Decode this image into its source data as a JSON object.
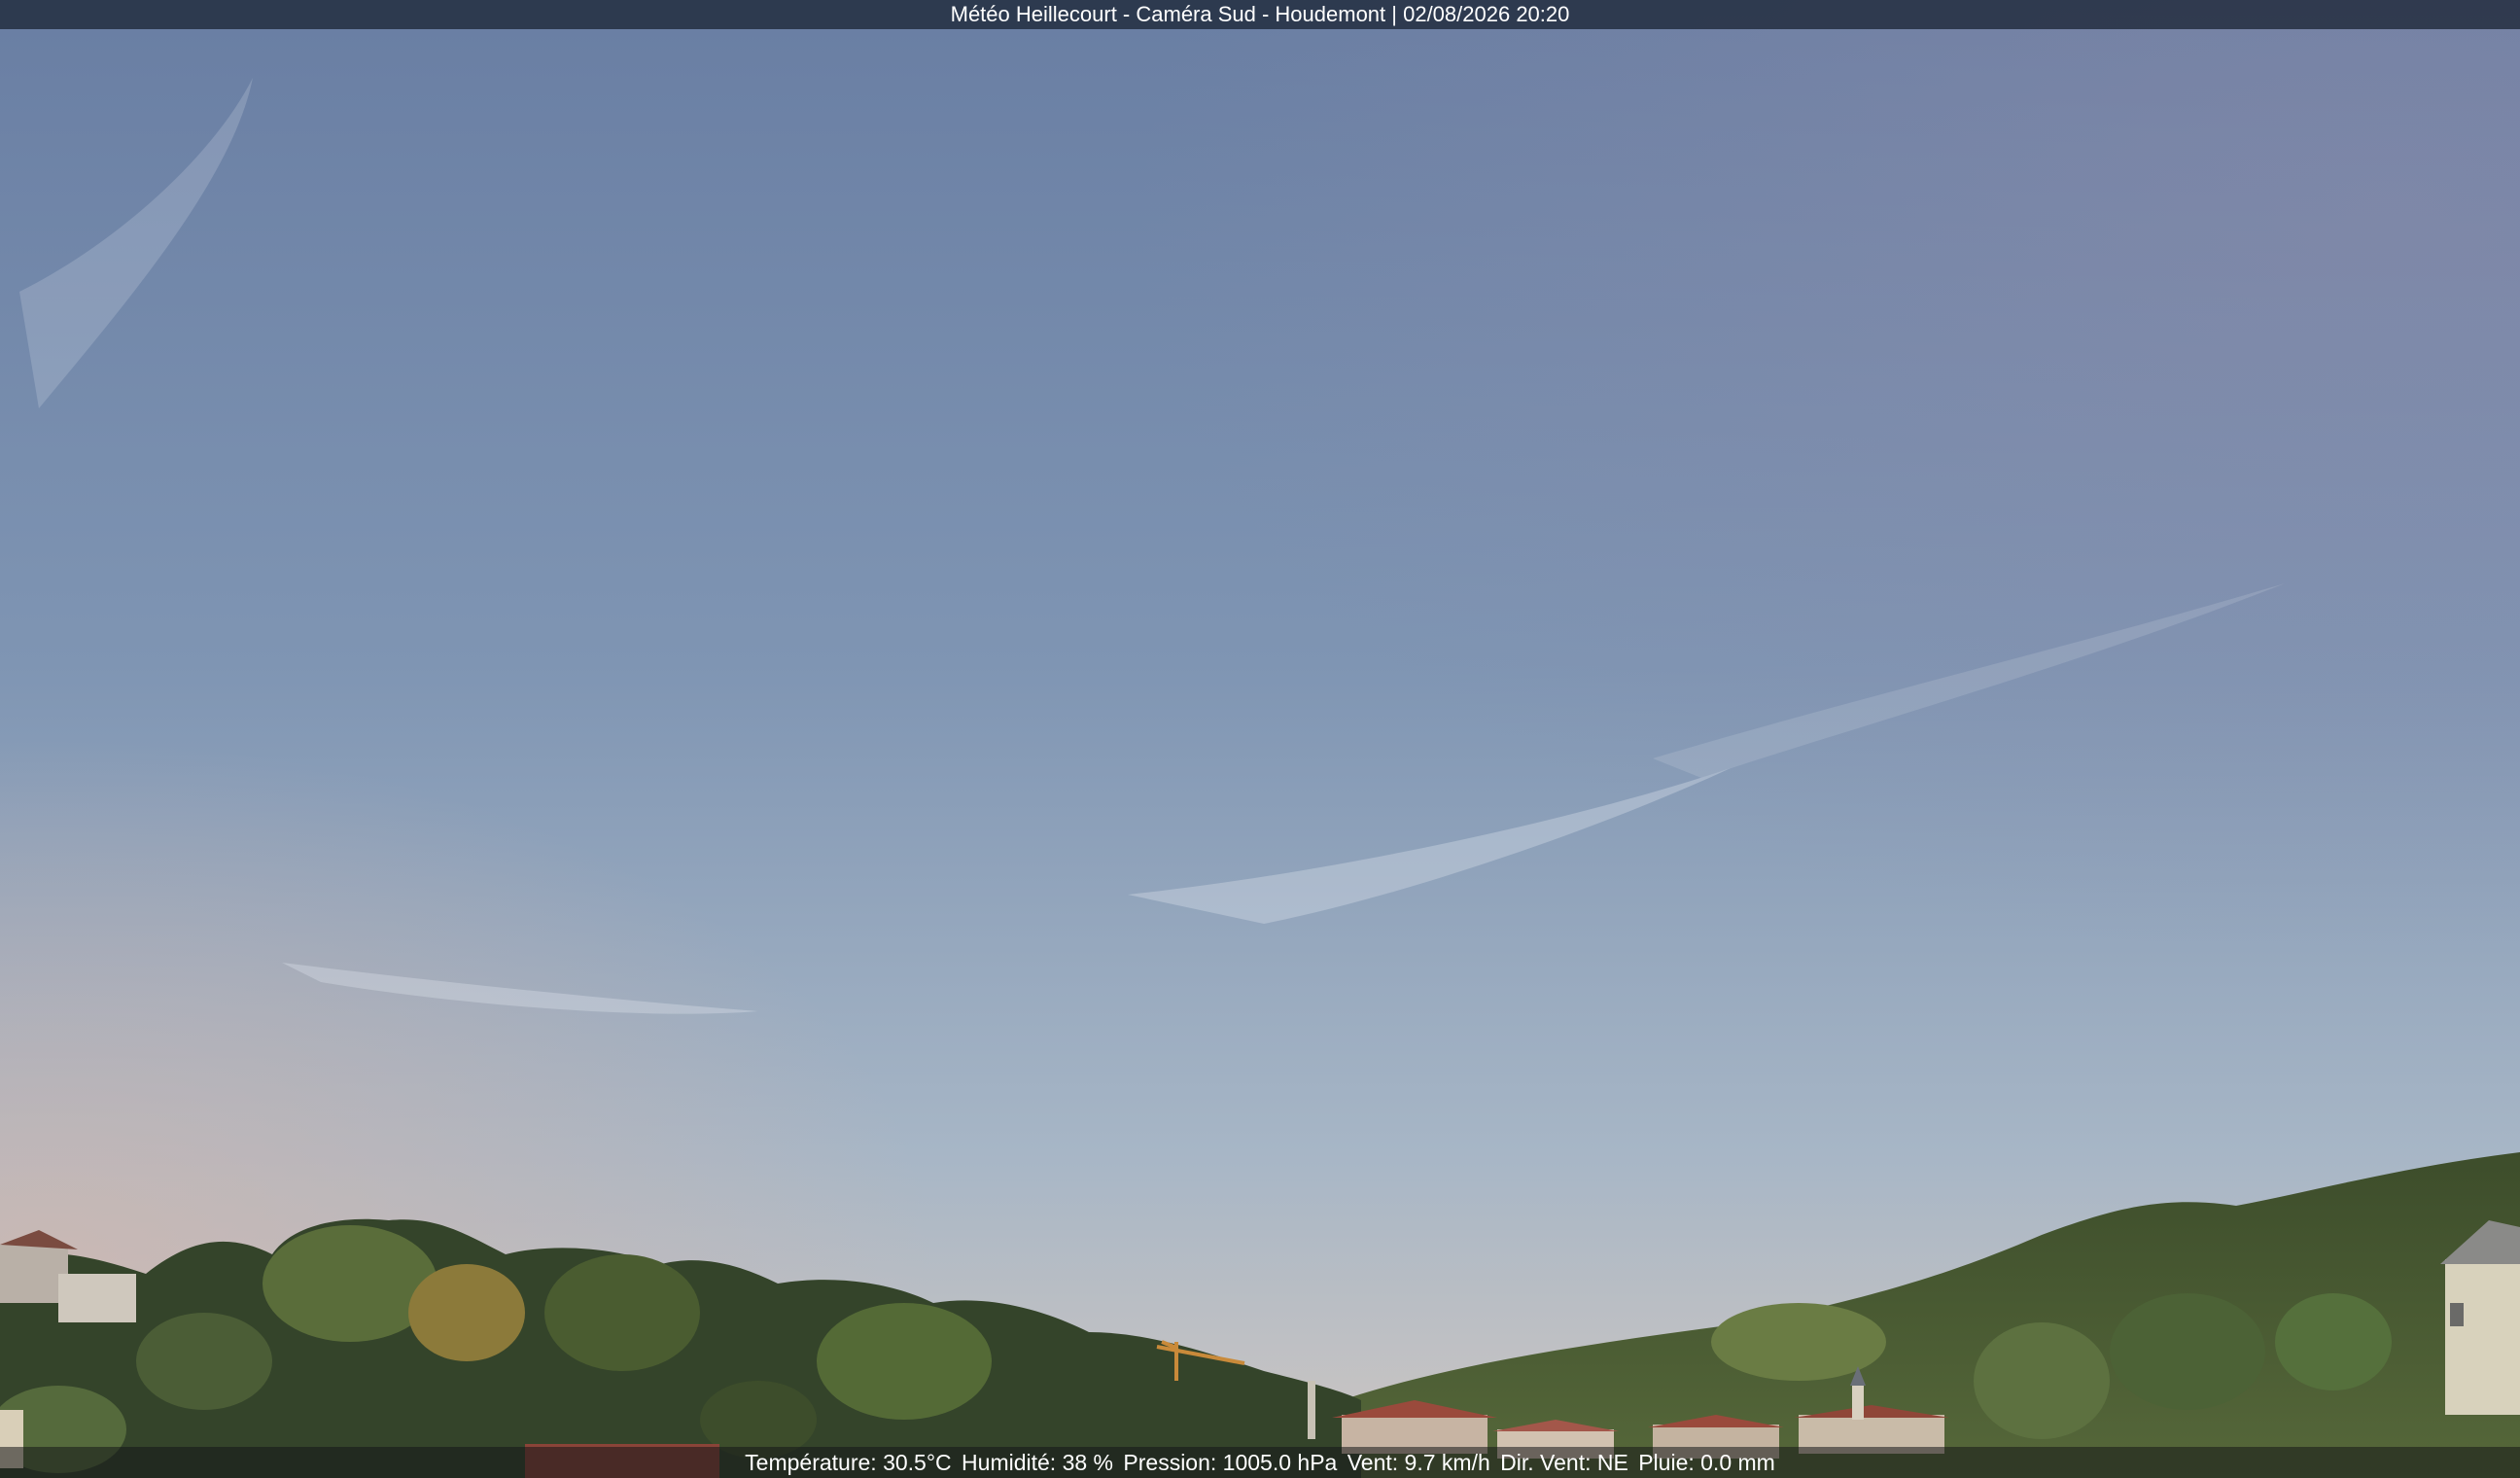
{
  "overlay": {
    "title": "Météo Heillecourt - Caméra Sud - Houdemont | 02/08/2026 20:20",
    "weather": {
      "temperature": "Température: 30.5°C",
      "humidity": "Humidité: 38 %",
      "pressure": "Pression: 1005.0 hPa",
      "wind": "Vent: 9.7 km/h",
      "wind_dir": "Dir. Vent: NE",
      "rain": "Pluie: 0.0 mm"
    }
  },
  "scene": {
    "sky_top": "#6a7ea3",
    "sky_mid": "#8ea3bd",
    "sky_horizon": "#c9c4c0",
    "tree_dark": "#2c3a22",
    "tree_mid": "#4a5e33",
    "tree_light": "#6f8a44",
    "roof_color": "#9a4a3c",
    "crane_color": "#c98a3a"
  }
}
